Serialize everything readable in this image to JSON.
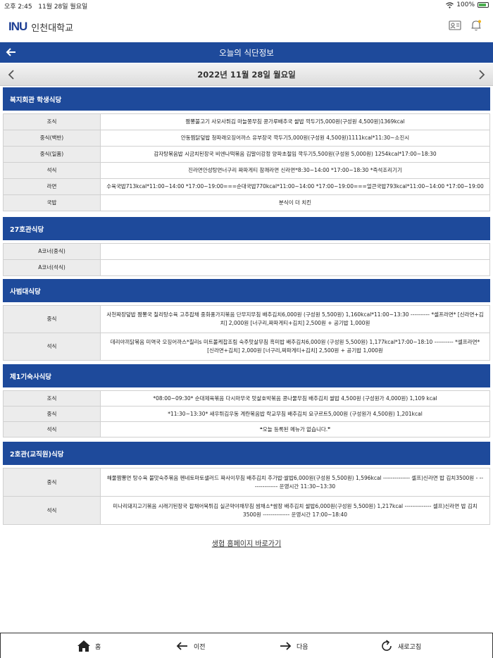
{
  "status_bar": {
    "time": "오후 2:45",
    "date": "11월 28일 월요일",
    "battery": "100%"
  },
  "header": {
    "logo_mark": "INU",
    "logo_text": "인천대학교"
  },
  "nav": {
    "title": "오늘의 식단정보"
  },
  "date_bar": {
    "date": "2022년 11월 28일 월요일"
  },
  "sections": [
    {
      "title": "복지회관 학생식당",
      "rows": [
        {
          "label": "조식",
          "value": "짬뽕불고기 사모사튀김 마늘쫑무침 콩가루배추국 쌀밥 깍두기5,000원(구성원 4,500원)1369kcal"
        },
        {
          "label": "중식(백반)",
          "value": "안동찜닭덮밥 청파래오징어까스 유부장국 깍두기5,000원(구성원 4,500원)1111kcal*11:30~소진시"
        },
        {
          "label": "중식(일품)",
          "value": "감자탕볶음밥 시금치된장국 비엔나떡볶음 김말이강정 양파초절임 깍두기5,500원(구성원 5,000원) 1254kcal*17:00~18:30"
        },
        {
          "label": "석식",
          "value": "진라면안성탕면너구리 짜파게티 참깨라면 신라면*8:30~14:00 *17:00~18:30 *즉석조리기기"
        },
        {
          "label": "라면",
          "value": "수육국밥713kcal*11:00~14:00 *17:00~19:00===순대국밥770kcal*11:00~14:00 *17:00~19:00===얼큰국밥793kcal*11:00~14:00 *17:00~19:00"
        },
        {
          "label": "국밥",
          "value": "분식이 더 치킨"
        }
      ]
    },
    {
      "title": "27호관식당",
      "rows": [
        {
          "label": "A코너(중식)",
          "value": ""
        },
        {
          "label": "A코너(석식)",
          "value": ""
        }
      ]
    },
    {
      "title": "사범대식당",
      "rows": [
        {
          "label": "중식",
          "value": "사천짜장덮밥 짬뽕국 칠리탕수육 고추잡채 중화풍가지볶음 단무지무침 배추김치6,000원 (구성원 5,500원) 1,160kcal*11:00~13:30 ---------- *셀프라면* [신라면+김치] 2,000원 [너구리,짜파게티+김치] 2,500원 + 공기밥 1,000원"
        },
        {
          "label": "석식",
          "value": "데리야끼닭볶음 미역국 오징어까스*칠리s 미트볼케찹조림 숙주맛살무침 흑미밥 배추김치6,000원 (구성원 5,500원) 1,177kcal*17:00~18:10 ---------- *셀프라면* [신라면+김치] 2,000원 [너구리,짜파게티+김치] 2,500원 + 공기밥 1,000원"
        }
      ]
    },
    {
      "title": "제1기숙사식당",
      "rows": [
        {
          "label": "조식",
          "value": "*08:00~09:30* 순대제육볶음 다시마무국 맛살호박볶음 콩나물무침 배추김치 쌀밥 4,500원 (구성원가 4,000원) 1,109 kcal"
        },
        {
          "label": "중식",
          "value": "*11:30~13:30* 새우튀김우동 계란볶음밥 락교무침 배추김치 요구르트5,000원 (구성원가 4,500원) 1,201kcal"
        },
        {
          "label": "석식",
          "value": "❝오늘 등록된 메뉴가 없습니다.❞"
        }
      ]
    },
    {
      "title": "2호관(교직원)식당",
      "rows": [
        {
          "label": "중식",
          "value": "해물짬뽕면 탕수육 불맛숙주볶음 펜네토마토샐러드 짜사이무침 배추김치 추가밥·쌀밥6,000원(구성원 5,500원) 1,596kcal -------------- 셀프)신라면 밥 김치3500원 - -------------- 운영시간 11:30~13:30"
        },
        {
          "label": "석식",
          "value": "미나리돼지고기볶음 시래기된장국 잡채어묵튀김 실곤약야채무침 쌈채소*쌈장 배추김치 쌀밥6,000원(구성원 5,500원) 1,217kcal -------------- 셀프)신라면 밥 김치3500원 -------------- 운영시간 17:00~18:40"
        }
      ]
    }
  ],
  "footer_link": "생협 홈페이지 바로가기",
  "tab_bar": {
    "home": "홈",
    "prev": "이전",
    "next": "다음",
    "refresh": "새로고침"
  },
  "colors": {
    "primary": "#1e4a9b",
    "logo_accent": "#f2b318",
    "label_bg": "#ececec"
  },
  "icons": [
    "wifi-icon",
    "battery-icon",
    "id-card-icon",
    "bell-icon",
    "back-arrow-icon",
    "chevron-left-icon",
    "chevron-right-icon",
    "home-icon",
    "arrow-left-icon",
    "arrow-right-icon",
    "refresh-icon"
  ]
}
